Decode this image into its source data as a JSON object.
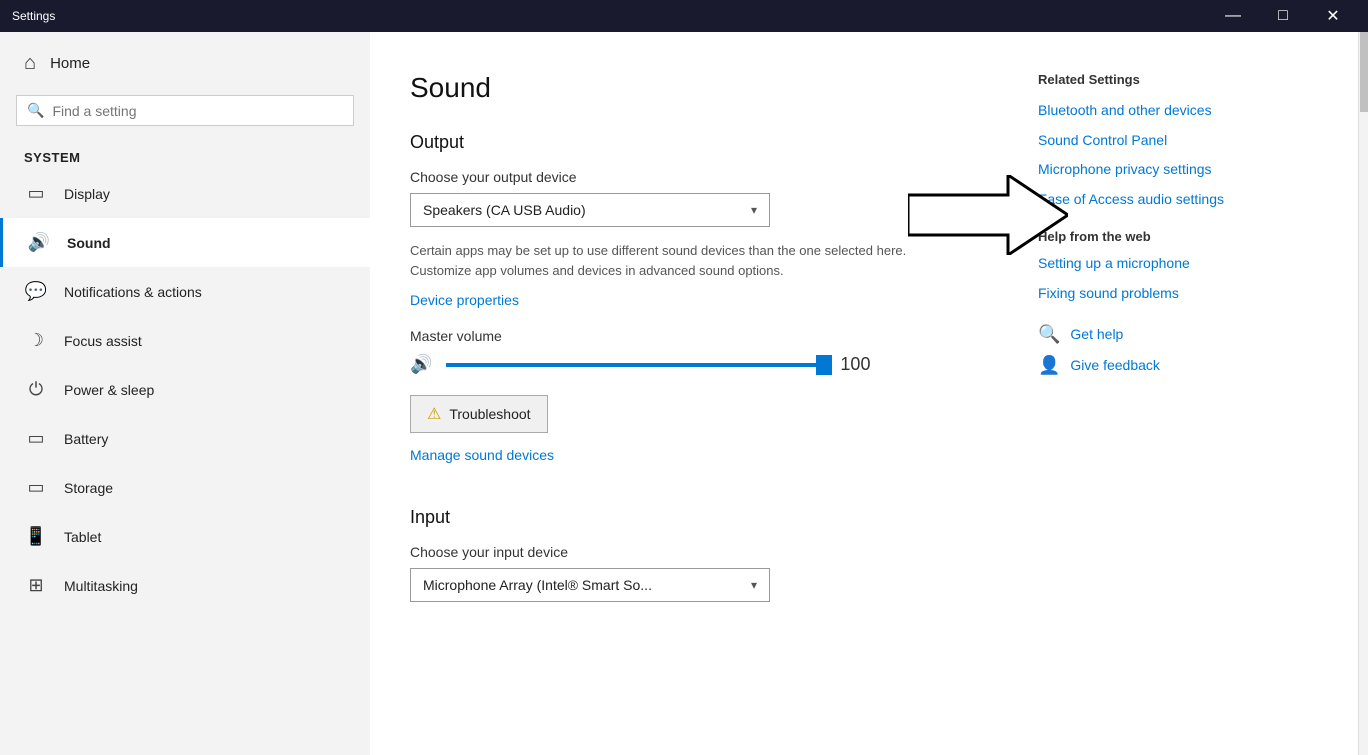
{
  "titlebar": {
    "title": "Settings",
    "minimize": "—",
    "maximize": "□",
    "close": "✕"
  },
  "sidebar": {
    "home_label": "Home",
    "search_placeholder": "Find a setting",
    "section_label": "System",
    "nav_items": [
      {
        "id": "display",
        "label": "Display",
        "icon": "🖥"
      },
      {
        "id": "sound",
        "label": "Sound",
        "icon": "🔊",
        "active": true
      },
      {
        "id": "notifications",
        "label": "Notifications & actions",
        "icon": "💬"
      },
      {
        "id": "focus",
        "label": "Focus assist",
        "icon": "🌙"
      },
      {
        "id": "power",
        "label": "Power & sleep",
        "icon": "⏻"
      },
      {
        "id": "battery",
        "label": "Battery",
        "icon": "🔋"
      },
      {
        "id": "storage",
        "label": "Storage",
        "icon": "💾"
      },
      {
        "id": "tablet",
        "label": "Tablet",
        "icon": "📱"
      },
      {
        "id": "multitasking",
        "label": "Multitasking",
        "icon": "⊞"
      }
    ]
  },
  "main": {
    "page_title": "Sound",
    "output_section": "Output",
    "output_device_label": "Choose your output device",
    "output_device_value": "Speakers (CA USB Audio)",
    "output_hint": "Certain apps may be set up to use different sound devices than the one selected here. Customize app volumes and devices in advanced sound options.",
    "device_properties_link": "Device properties",
    "volume_label": "Master volume",
    "volume_value": "100",
    "troubleshoot_label": "Troubleshoot",
    "manage_link": "Manage sound devices",
    "input_section": "Input",
    "input_device_label": "Choose your input device",
    "input_device_value": "Microphone Array (Intel® Smart So..."
  },
  "related": {
    "title": "Related Settings",
    "links": [
      "Bluetooth and other devices",
      "Sound Control Panel",
      "Microphone privacy settings",
      "Ease of Access audio settings"
    ],
    "help_title": "Help from the web",
    "help_links": [
      {
        "icon": "🔍",
        "label": "Setting up a microphone"
      },
      {
        "icon": "🔍",
        "label": "Fixing sound problems"
      }
    ],
    "get_help_label": "Get help",
    "give_feedback_label": "Give feedback"
  }
}
